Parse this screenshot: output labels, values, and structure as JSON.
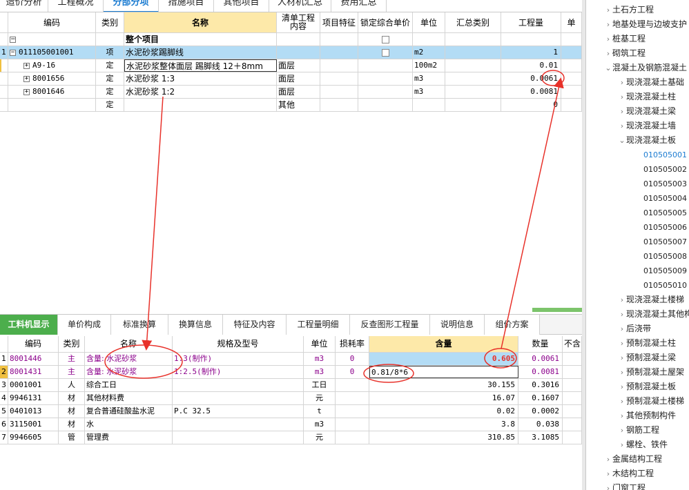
{
  "top_tabs": [
    "造价分析",
    "工程概况",
    "分部分项",
    "措施项目",
    "其他项目",
    "人材机汇总",
    "费用汇总"
  ],
  "top_grid": {
    "headers": [
      "编码",
      "类别",
      "名称",
      "清单工程内容",
      "项目特征",
      "锁定综合单价",
      "单位",
      "汇总类别",
      "工程量",
      "单"
    ],
    "rows": [
      {
        "num": "",
        "code": "",
        "type": "",
        "name": "整个项目",
        "content": "",
        "unit": "",
        "qty": ""
      },
      {
        "num": "1",
        "code": "011105001001",
        "type": "项",
        "name": "水泥砂浆踢脚线",
        "content": "",
        "unit": "m2",
        "qty": "1"
      },
      {
        "num": "",
        "code": "A9-16",
        "type": "定",
        "name": "水泥砂浆整体面层 踢脚线 12＋8mm",
        "content": "面层",
        "unit": "100m2",
        "qty": "0.01"
      },
      {
        "num": "",
        "code": "8001656",
        "type": "定",
        "name": "水泥砂浆 1:3",
        "content": "面层",
        "unit": "m3",
        "qty": "0.0061"
      },
      {
        "num": "",
        "code": "8001646",
        "type": "定",
        "name": "水泥砂浆 1:2",
        "content": "面层",
        "unit": "m3",
        "qty": "0.0081"
      },
      {
        "num": "",
        "code": "",
        "type": "定",
        "name": "",
        "content": "其他",
        "unit": "",
        "qty": "0"
      }
    ]
  },
  "bottom_tabs": [
    "工料机显示",
    "单价构成",
    "标准换算",
    "换算信息",
    "特征及内容",
    "工程量明细",
    "反查图形工程量",
    "说明信息",
    "组价方案"
  ],
  "bottom_grid": {
    "headers": [
      "编码",
      "类别",
      "名称",
      "规格及型号",
      "单位",
      "损耗率",
      "含量",
      "数量",
      "不含"
    ],
    "rows": [
      {
        "num": "1",
        "code": "8001446",
        "type": "主",
        "name": "含量: 水泥砂浆",
        "spec": "1:3(制作)",
        "unit": "m3",
        "loss": "0",
        "content": "0.605",
        "qty": "0.0061"
      },
      {
        "num": "2",
        "code": "8001431",
        "type": "主",
        "name": "含量: 水泥砂浆",
        "spec": "1:2.5(制作)",
        "unit": "m3",
        "loss": "0",
        "content": "0.81/8*6",
        "qty": "0.0081"
      },
      {
        "num": "3",
        "code": "0001001",
        "type": "人",
        "name": "综合工日",
        "spec": "",
        "unit": "工日",
        "loss": "",
        "content": "30.155",
        "qty": "0.3016"
      },
      {
        "num": "4",
        "code": "9946131",
        "type": "材",
        "name": "其他材料费",
        "spec": "",
        "unit": "元",
        "loss": "",
        "content": "16.07",
        "qty": "0.1607"
      },
      {
        "num": "5",
        "code": "0401013",
        "type": "材",
        "name": "复合普通硅酸盐水泥",
        "spec": "P.C 32.5",
        "unit": "t",
        "loss": "",
        "content": "0.02",
        "qty": "0.0002"
      },
      {
        "num": "6",
        "code": "3115001",
        "type": "材",
        "name": "水",
        "spec": "",
        "unit": "m3",
        "loss": "",
        "content": "3.8",
        "qty": "0.038"
      },
      {
        "num": "7",
        "code": "9946605",
        "type": "管",
        "name": "管理费",
        "spec": "",
        "unit": "元",
        "loss": "",
        "content": "310.85",
        "qty": "3.1085"
      }
    ]
  },
  "tree": [
    {
      "label": "土石方工程",
      "level": 1,
      "state": "collapsed"
    },
    {
      "label": "地基处理与边坡支护",
      "level": 1,
      "state": "collapsed"
    },
    {
      "label": "桩基工程",
      "level": 1,
      "state": "collapsed"
    },
    {
      "label": "砌筑工程",
      "level": 1,
      "state": "collapsed"
    },
    {
      "label": "混凝土及钢筋混凝土",
      "level": 1,
      "state": "expanded"
    },
    {
      "label": "现浇混凝土基础",
      "level": 2,
      "state": "collapsed"
    },
    {
      "label": "现浇混凝土柱",
      "level": 2,
      "state": "collapsed"
    },
    {
      "label": "现浇混凝土梁",
      "level": 2,
      "state": "collapsed"
    },
    {
      "label": "现浇混凝土墙",
      "level": 2,
      "state": "collapsed"
    },
    {
      "label": "现浇混凝土板",
      "level": 2,
      "state": "expanded"
    },
    {
      "label": "010505001",
      "level": 3,
      "state": "selected"
    },
    {
      "label": "010505002",
      "level": 3,
      "state": "leaf"
    },
    {
      "label": "010505003",
      "level": 3,
      "state": "leaf"
    },
    {
      "label": "010505004",
      "level": 3,
      "state": "leaf"
    },
    {
      "label": "010505005",
      "level": 3,
      "state": "leaf"
    },
    {
      "label": "010505006",
      "level": 3,
      "state": "leaf"
    },
    {
      "label": "010505007",
      "level": 3,
      "state": "leaf"
    },
    {
      "label": "010505008",
      "level": 3,
      "state": "leaf"
    },
    {
      "label": "010505009",
      "level": 3,
      "state": "leaf"
    },
    {
      "label": "010505010",
      "level": 3,
      "state": "leaf"
    },
    {
      "label": "现浇混凝土楼梯",
      "level": 2,
      "state": "collapsed"
    },
    {
      "label": "现浇混凝土其他构",
      "level": 2,
      "state": "collapsed"
    },
    {
      "label": "后浇带",
      "level": 2,
      "state": "collapsed"
    },
    {
      "label": "预制混凝土柱",
      "level": 2,
      "state": "collapsed"
    },
    {
      "label": "预制混凝土梁",
      "level": 2,
      "state": "collapsed"
    },
    {
      "label": "预制混凝土屋架",
      "level": 2,
      "state": "collapsed"
    },
    {
      "label": "预制混凝土板",
      "level": 2,
      "state": "collapsed"
    },
    {
      "label": "预制混凝土楼梯",
      "level": 2,
      "state": "collapsed"
    },
    {
      "label": "其他预制构件",
      "level": 2,
      "state": "collapsed"
    },
    {
      "label": "钢筋工程",
      "level": 2,
      "state": "collapsed"
    },
    {
      "label": "螺栓、铁件",
      "level": 2,
      "state": "collapsed"
    },
    {
      "label": "金属结构工程",
      "level": 1,
      "state": "collapsed"
    },
    {
      "label": "木结构工程",
      "level": 1,
      "state": "collapsed"
    },
    {
      "label": "门窗工程",
      "level": 1,
      "state": "collapsed"
    }
  ],
  "colors": {
    "accent": "#1a7bd1",
    "selected_row": "#b3dcf5",
    "header_highlight": "#fde9a9",
    "main_material": "#8b008b",
    "annotation": "#e8312a",
    "tab_active": "#4cae4c"
  }
}
